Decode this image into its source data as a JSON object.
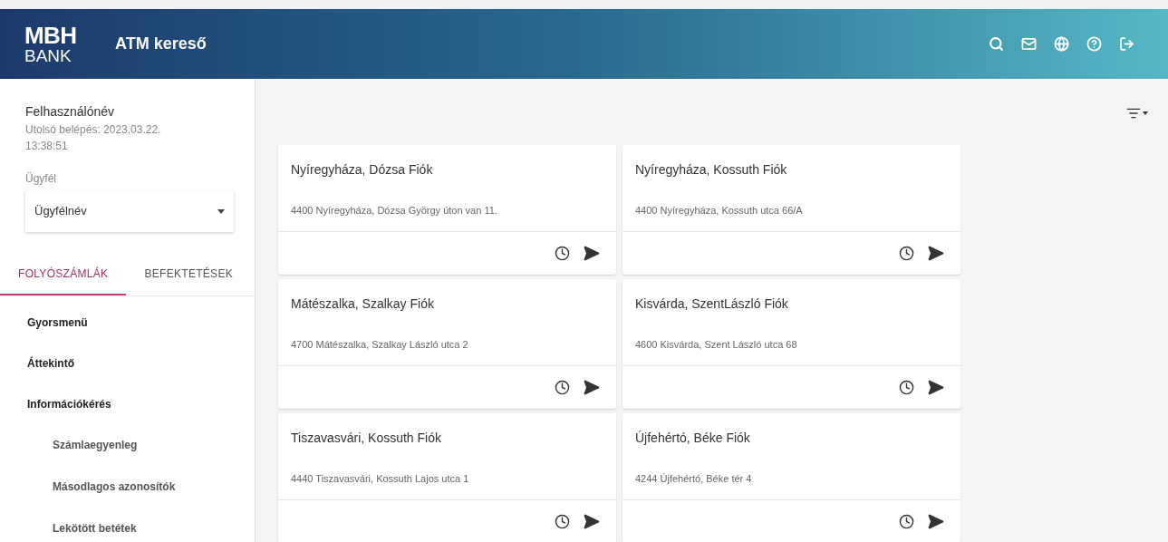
{
  "header": {
    "logo_top": "MBH",
    "logo_bottom": "BANK",
    "title": "ATM kereső"
  },
  "sidebar": {
    "username": "Felhasználónév",
    "last_login": "Utolsó belépés: 2023.03.22. 13:38:51",
    "client_label": "Ügyfél",
    "client_value": "Ügyfélnév",
    "tabs": [
      {
        "label": "FOLYÓSZÁMLÁK",
        "selected": true
      },
      {
        "label": "BEFEKTETÉSEK",
        "selected": false
      }
    ],
    "menu": [
      {
        "label": "Gyorsmenü"
      },
      {
        "label": "Áttekintő"
      },
      {
        "label": "Információkérés",
        "children": [
          {
            "label": "Számlaegyenleg"
          },
          {
            "label": "Másodlagos azonosítók"
          },
          {
            "label": "Lekötött betétek"
          }
        ]
      }
    ]
  },
  "branches": [
    {
      "name": "Nyíregyháza, Dózsa Fiók",
      "address": "4400 Nyíregyháza, Dózsa György úton van 11."
    },
    {
      "name": "Nyíregyháza, Kossuth Fiók",
      "address": "4400 Nyíregyháza, Kossuth utca 66/A"
    },
    {
      "name": "Mátészalka, Szalkay Fiók",
      "address": "4700 Mátészalka, Szalkay László utca 2"
    },
    {
      "name": "Kisvárda, SzentLászló Fiók",
      "address": "4600 Kisvárda, Szent László utca 68"
    },
    {
      "name": "Tiszavasvári, Kossuth Fiók",
      "address": "4440 Tiszavasvári, Kossuth Lajos utca 1"
    },
    {
      "name": "Újfehértó, Béke Fiók",
      "address": "4244 Újfehértó, Béke tér 4"
    }
  ]
}
